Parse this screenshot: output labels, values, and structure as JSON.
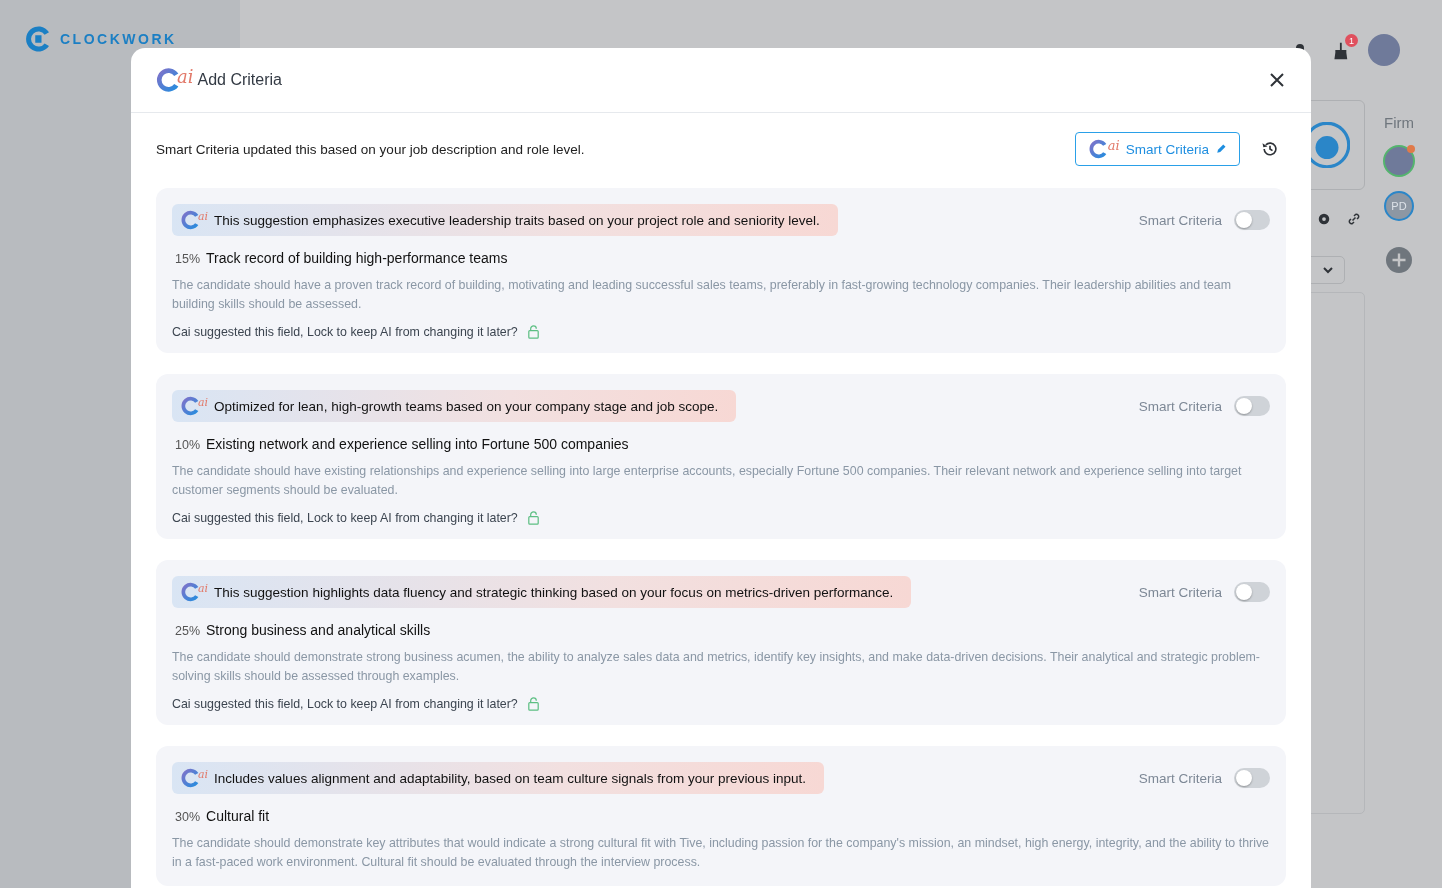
{
  "app": {
    "brand": "CLOCKWORK",
    "notification_count": "1",
    "side_label": "Firm",
    "initials": "PD"
  },
  "dialog": {
    "logo": "ai",
    "title": "Add Criteria",
    "intro": "Smart Criteria updated this based on your job description and role level.",
    "smart_button": {
      "logo": "ai",
      "label": "Smart Criteria"
    },
    "criteria": [
      {
        "badge": "ai",
        "suggestion": "This suggestion emphasizes executive leadership traits based on your project role and seniority level.",
        "toggle_label": "Smart Criteria",
        "on": false,
        "weight": "15%",
        "title": "Track record of building high-performance teams",
        "description": "The candidate should have a proven track record of building, motivating and leading successful sales teams, preferably in fast-growing technology companies. Their leadership abilities and team building skills should be assessed.",
        "lock_prompt": "Cai suggested this field, Lock to keep AI from changing it later?",
        "locked": false
      },
      {
        "badge": "ai",
        "suggestion": "Optimized for lean, high-growth teams based on your company stage and job scope.",
        "toggle_label": "Smart Criteria",
        "on": false,
        "weight": "10%",
        "title": "Existing network and experience selling into Fortune 500 companies",
        "description": "The candidate should have existing relationships and experience selling into large enterprise accounts, especially Fortune 500 companies. Their relevant network and experience selling into target customer segments should be evaluated.",
        "lock_prompt": "Cai suggested this field, Lock to keep AI from changing it later?",
        "locked": false
      },
      {
        "badge": "ai",
        "suggestion": "This suggestion highlights data fluency and strategic thinking based on your focus on metrics-driven performance.",
        "toggle_label": "Smart Criteria",
        "on": false,
        "weight": "25%",
        "title": "Strong business and analytical skills",
        "description": "The candidate should demonstrate strong business acumen, the ability to analyze sales data and metrics, identify key insights, and make data-driven decisions. Their analytical and strategic problem-solving skills should be assessed through examples.",
        "lock_prompt": "Cai suggested this field, Lock to keep AI from changing it later?",
        "locked": false
      },
      {
        "badge": "ai",
        "suggestion": "Includes values alignment and adaptability, based on team culture signals from your previous input.",
        "toggle_label": "Smart Criteria",
        "on": false,
        "weight": "30%",
        "title": "Cultural fit",
        "description": "The candidate should demonstrate key attributes that would indicate a strong cultural fit with Tive, including passion for the company's mission, an mindset, high energy, integrity, and the ability to thrive in a fast-paced work environment. Cultural fit should be evaluated through the interview process."
      }
    ]
  }
}
